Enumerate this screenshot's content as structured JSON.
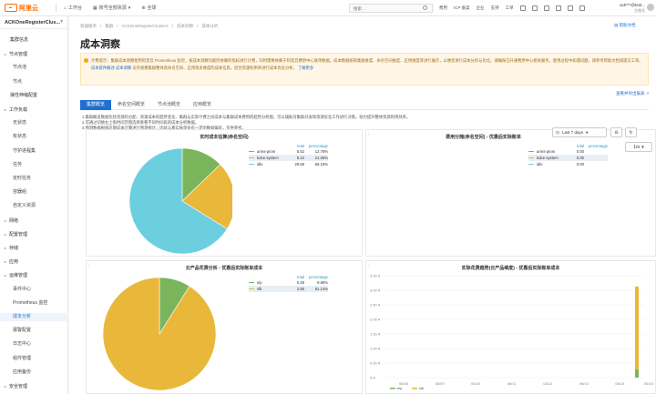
{
  "topbar": {
    "brand": "阿里云",
    "workbench": "工作台",
    "account": "账号全部资源",
    "region": "全球",
    "search_placeholder": "搜索...",
    "links": [
      "费用",
      "ICP 备案",
      "企业",
      "支持",
      "工单"
    ],
    "user_name": "ack***@test...",
    "user_sub": "主账号"
  },
  "sidebar": {
    "cluster": "ACKOneRegisterClus...",
    "items": [
      {
        "label": "集群信息",
        "kind": "top"
      },
      {
        "label": "节点管理",
        "kind": "group"
      },
      {
        "label": "节点池",
        "kind": "sub"
      },
      {
        "label": "节点",
        "kind": "sub"
      },
      {
        "label": "弹性伸缩配置",
        "kind": "top"
      },
      {
        "label": "工作负载",
        "kind": "group"
      },
      {
        "label": "无状态",
        "kind": "sub"
      },
      {
        "label": "有状态",
        "kind": "sub"
      },
      {
        "label": "守护进程集",
        "kind": "sub"
      },
      {
        "label": "任务",
        "kind": "sub"
      },
      {
        "label": "定时任务",
        "kind": "sub"
      },
      {
        "label": "容器组",
        "kind": "sub"
      },
      {
        "label": "自定义资源",
        "kind": "sub"
      },
      {
        "label": "网络",
        "kind": "group"
      },
      {
        "label": "配置管理",
        "kind": "group"
      },
      {
        "label": "存储",
        "kind": "group"
      },
      {
        "label": "应用",
        "kind": "group"
      },
      {
        "label": "运维管理",
        "kind": "group"
      },
      {
        "label": "事件中心",
        "kind": "sub"
      },
      {
        "label": "Prometheus 监控",
        "kind": "sub"
      },
      {
        "label": "成本分析",
        "kind": "sub",
        "active": true
      },
      {
        "label": "报警配置",
        "kind": "sub"
      },
      {
        "label": "日志中心",
        "kind": "sub"
      },
      {
        "label": "组件管理",
        "kind": "sub"
      },
      {
        "label": "应用备份",
        "kind": "sub"
      },
      {
        "label": "安全管理",
        "kind": "group"
      }
    ]
  },
  "breadcrumb": [
    "容器服务",
    "集群",
    "ACKOneRegisterCluster1",
    "成本洞察",
    "成本分析"
  ],
  "help_link": "帮助文档",
  "page_title": "成本洞察",
  "notice": {
    "text": "计费提示：集群成本洞察使用阿里云 Prometheus 监控，按成本洞察功能所依赖的指标进行计费，同时需要依赖于阿里云费用中心账单数据。成本数据按照集群维度、命名空间维度、应用维度等进行展示，以便您进行成本分析与优化。请确保已开通费用中心相关服务。使用过程中如遇问题，请参考帮助文档或提交工单。",
    "link1": "成本套件概述",
    "link2": "成本洞察",
    "tail": "支持查看集群整体及命名空间、应用等多维度的成本信息，结合资源利用率进行成本优化分析，",
    "link3": "了解更多"
  },
  "export_link": "查看并导出报表",
  "tabs": [
    "集群概览",
    "命名空间概览",
    "节点池概览",
    "应用概览"
  ],
  "description": [
    "1.集群概览数据包括资源的分配、资源成本的趋势变化、集群与实际计费之间成本与集群成本费用的趋势分析图，可以辅助对集群开发和资源优化工作进行决策，助力提升整体资源利用效率。",
    "2.可通过切换左上角时间范围选择查看不同时间段的成本分析数据。",
    "3.预测数据根据近期成本计算进行预测统计，因此与真实账单会有一定的数据偏差，仅供参考。"
  ],
  "controls": {
    "time_range": "Last 7 days",
    "refresh_interval": "1m"
  },
  "panels": {
    "realtime": {
      "title": "实时成本估算(命名空间)",
      "header": {
        "name": "",
        "total": "total",
        "pct": "percentage"
      },
      "rows": [
        {
          "name": "arms-prom",
          "total": "5.52",
          "pct": "12.78%",
          "color": "#7ab55c"
        },
        {
          "name": "kube-system",
          "total": "9.10",
          "pct": "21.06%",
          "color": "#e9b83b"
        },
        {
          "name": "idle",
          "total": "28.58",
          "pct": "66.16%",
          "color": "#6ccfe0"
        }
      ]
    },
    "namespace_split": {
      "title": "费用分摊(命名空间) - 优惠后实际账单",
      "header": {
        "name": "",
        "total": "total",
        "pct": "percentage"
      },
      "rows": [
        {
          "name": "arms-prom",
          "total": "0.00",
          "pct": "",
          "color": "#7ab55c"
        },
        {
          "name": "kube-system",
          "total": "0.00",
          "pct": "",
          "color": "#e9b83b"
        },
        {
          "name": "idle",
          "total": "0.00",
          "pct": "",
          "color": "#6ccfe0"
        }
      ]
    },
    "cloud_product": {
      "title": "云产品花费分析 - 优惠后实际账单成本",
      "header": {
        "name": "",
        "total": "total",
        "pct": "percentage"
      },
      "rows": [
        {
          "name": "eip",
          "total": "0.28",
          "pct": "8.86%",
          "color": "#7ab55c"
        },
        {
          "name": "slb",
          "total": "2.85",
          "pct": "91.14%",
          "color": "#e9b83b"
        }
      ]
    },
    "trend": {
      "title": "实际花费趋势(云产品维度) - 优惠后实际账单成本",
      "legend": [
        {
          "name": "eip",
          "color": "#7ab55c"
        },
        {
          "name": "slb",
          "color": "#e9b83b"
        }
      ]
    }
  },
  "chart_data": [
    {
      "type": "pie",
      "title": "实时成本估算(命名空间)",
      "categories": [
        "arms-prom",
        "kube-system",
        "idle"
      ],
      "values": [
        5.52,
        9.1,
        28.58
      ],
      "colors": [
        "#7ab55c",
        "#e9b83b",
        "#6ccfe0"
      ]
    },
    {
      "type": "pie",
      "title": "云产品花费分析 - 优惠后实际账单成本",
      "categories": [
        "eip",
        "slb"
      ],
      "values": [
        0.28,
        2.85
      ],
      "colors": [
        "#7ab55c",
        "#e9b83b"
      ]
    },
    {
      "type": "bar",
      "title": "实际花费趋势(云产品维度) - 优惠后实际账单成本",
      "categories": [
        "06/08",
        "06/09",
        "06/10",
        "06/11",
        "06/12",
        "06/13",
        "06/14",
        "06/15"
      ],
      "ytick_labels": [
        "0 ¥",
        "0.50 ¥",
        "1.00 ¥",
        "1.50 ¥",
        "2.00 ¥",
        "2.50 ¥",
        "3.00 ¥",
        "3.50 ¥"
      ],
      "ylim": [
        0,
        3.5
      ],
      "series": [
        {
          "name": "eip",
          "values": [
            0,
            0,
            0,
            0,
            0,
            0,
            0,
            0.28
          ],
          "color": "#7ab55c"
        },
        {
          "name": "slb",
          "values": [
            0,
            0,
            0,
            0,
            0,
            0,
            0,
            2.85
          ],
          "color": "#e9b83b"
        }
      ]
    }
  ]
}
